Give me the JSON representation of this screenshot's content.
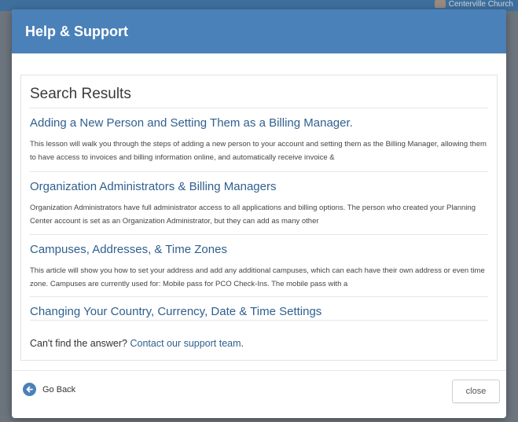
{
  "background": {
    "user_label": "Centerville Church"
  },
  "modal": {
    "title": "Help & Support",
    "search": {
      "heading": "Search Results",
      "results": [
        {
          "title": "Adding a New Person and Setting Them as a Billing Manager.",
          "snippet": "This lesson will walk you through the steps of adding a new person to your account and setting them as the Billing Manager, allowing them to have access to invoices and billing information online, and automatically receive invoice &"
        },
        {
          "title": "Organization Administrators & Billing Managers",
          "snippet": "Organization Administrators have full administrator access to all applications and billing options. The person who created your Planning Center account is set as an Organization Administrator, but they can add as many other"
        },
        {
          "title": "Campuses, Addresses, & Time Zones",
          "snippet": "This article will show you how to set your address and add any additional campuses, which can each have their own address or even time zone. Campuses are currently used for: Mobile pass for PCO Check-Ins. The mobile pass with a"
        },
        {
          "title": "Changing Your Country, Currency, Date & Time Settings",
          "snippet": ""
        }
      ],
      "no_answer_prefix": "Can't find the answer?",
      "contact_link": "Contact our support team",
      "no_answer_suffix": "."
    },
    "footer": {
      "go_back_label": "Go Back",
      "close_label": "close"
    }
  },
  "colors": {
    "header": "#4a81b8",
    "link": "#2f5f8f"
  }
}
